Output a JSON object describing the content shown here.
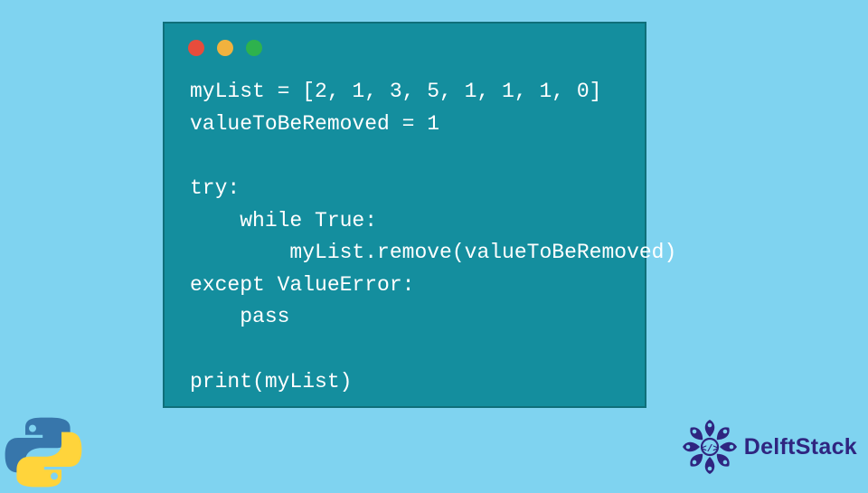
{
  "code_window": {
    "dots": [
      "red",
      "yellow",
      "green"
    ],
    "lines": [
      "myList = [2, 1, 3, 5, 1, 1, 1, 0]",
      "valueToBeRemoved = 1",
      "",
      "try:",
      "    while True:",
      "        myList.remove(valueToBeRemoved)",
      "except ValueError:",
      "    pass",
      "",
      "print(myList)"
    ]
  },
  "brand": {
    "name": "DelftStack",
    "logo": "mandala-icon",
    "logo_color": "#2F2580"
  },
  "python_logo": {
    "name": "python-icon",
    "colors": {
      "top": "#3776AB",
      "bottom": "#FFD43B"
    }
  },
  "colors": {
    "page_bg": "#7FD3F0",
    "window_bg": "#148E9E",
    "window_border": "#0F6F7A",
    "code_text": "#FFFFFF"
  }
}
